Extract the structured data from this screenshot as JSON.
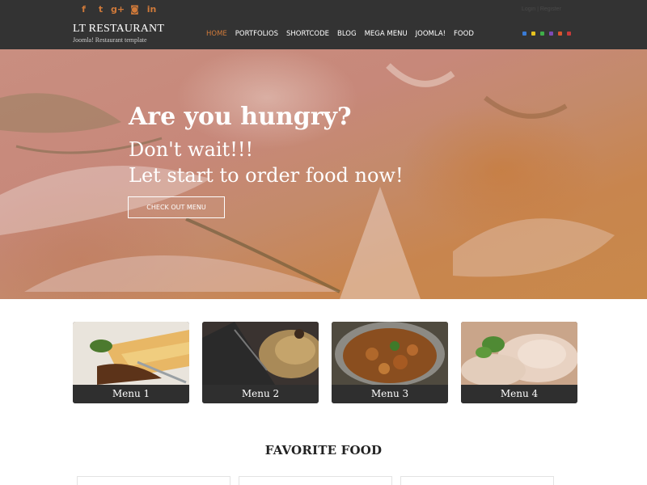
{
  "header": {
    "brand_name": "LT RESTAURANT",
    "brand_tagline": "Joomla! Restaurant template",
    "top_right_text": "Login | Register",
    "social": [
      {
        "icon": "facebook-icon",
        "glyph": "f"
      },
      {
        "icon": "twitter-icon",
        "glyph": "t"
      },
      {
        "icon": "google-plus-icon",
        "glyph": "g+"
      },
      {
        "icon": "instagram-icon",
        "glyph": "◙"
      },
      {
        "icon": "linkedin-icon",
        "glyph": "in"
      }
    ],
    "nav": [
      {
        "label": "HOME",
        "active": true
      },
      {
        "label": "PORTFOLIOS",
        "active": false
      },
      {
        "label": "SHORTCODE",
        "active": false
      },
      {
        "label": "BLOG",
        "active": false
      },
      {
        "label": "MEGA MENU",
        "active": false
      },
      {
        "label": "JOOMLA!",
        "active": false
      },
      {
        "label": "FOOD",
        "active": false
      }
    ],
    "color_swatches": [
      "#3a7bd5",
      "#e6c21f",
      "#3fae49",
      "#7d4bb5",
      "#d9572e",
      "#c83a3a"
    ]
  },
  "colors": {
    "accent": "#d07a3a",
    "header_bg": "#333333",
    "card_bar": "#2f2f2f"
  },
  "hero": {
    "title": "Are you hungry?",
    "line1": "Don't wait!!!",
    "line2": "Let start to order food now!",
    "button_label": "CHECK OUT MENU"
  },
  "menu_cards": [
    {
      "label": "Menu 1"
    },
    {
      "label": "Menu 2"
    },
    {
      "label": "Menu 3"
    },
    {
      "label": "Menu 4"
    }
  ],
  "favorite": {
    "title": "FAVORITE FOOD"
  }
}
